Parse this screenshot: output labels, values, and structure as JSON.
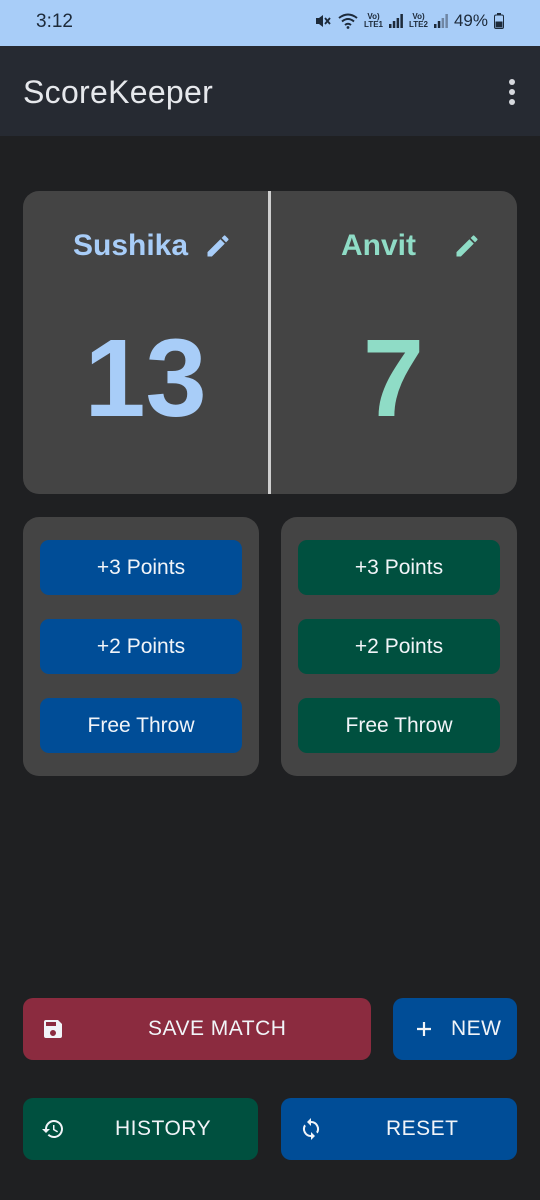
{
  "status_bar": {
    "time": "3:12",
    "net1_top": "Vo)",
    "net1_bottom": "LTE1",
    "net2_top": "Vo)",
    "net2_bottom": "LTE2",
    "battery": "49%"
  },
  "app_bar": {
    "title": "ScoreKeeper",
    "menu_icon": "more-vert-icon"
  },
  "teams": [
    {
      "name": "Sushika",
      "score": "13",
      "color": "#a8cdf8"
    },
    {
      "name": "Anvit",
      "score": "7",
      "color": "#8fdcc6"
    }
  ],
  "point_buttons": {
    "team_a": [
      "+3 Points",
      "+2 Points",
      "Free Throw"
    ],
    "team_b": [
      "+3 Points",
      "+2 Points",
      "Free Throw"
    ]
  },
  "actions": {
    "save": {
      "label": "SAVE MATCH",
      "icon": "save-icon",
      "color": "#8b2b3f"
    },
    "new": {
      "label": "NEW",
      "icon": "plus-icon",
      "color": "#004d97"
    },
    "history": {
      "label": "HISTORY",
      "icon": "history-icon",
      "color": "#00503f"
    },
    "reset": {
      "label": "RESET",
      "icon": "sync-icon",
      "color": "#004d97"
    }
  },
  "colors": {
    "background": "#1f2022",
    "app_bar": "#262a32",
    "status_bar": "#a8cdf8",
    "card": "#444444",
    "blue_button": "#004d97",
    "green_button": "#00503f"
  }
}
